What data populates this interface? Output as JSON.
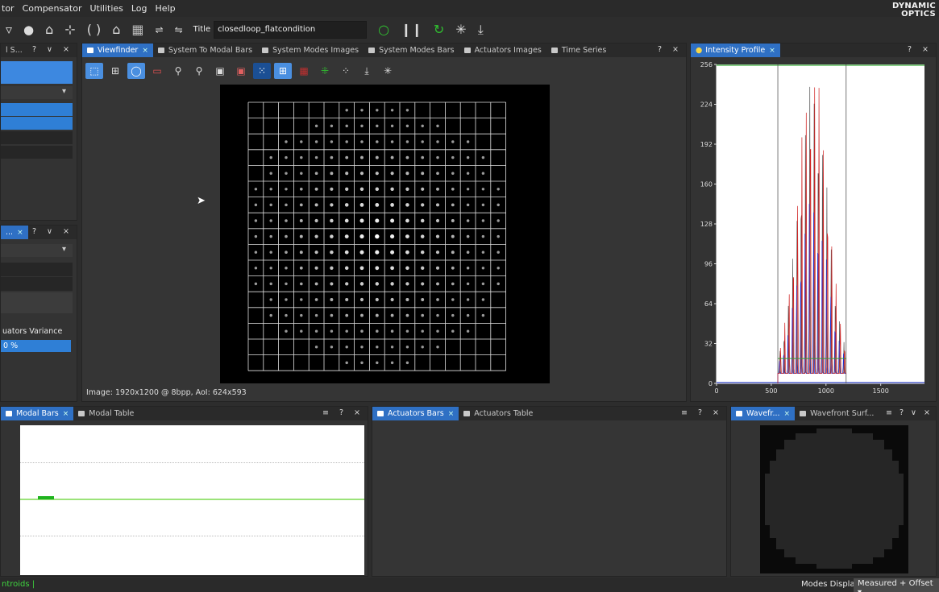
{
  "menu": [
    "tor",
    "Compensator",
    "Utilities",
    "Log",
    "Help"
  ],
  "logo": {
    "line1": "DYNAMIC",
    "line2": "OPTICS"
  },
  "toolbar": {
    "title_label": "Title",
    "title_value": "closedloop_flatcondition"
  },
  "left_panel_top": {
    "title": "l S...",
    "controls": "? ∨ ×"
  },
  "left_panel_bottom": {
    "tab": "...",
    "controls": "? ∨ ×",
    "variance_label": "uators Variance",
    "variance_value": "0 %"
  },
  "viewfinder": {
    "tabs": [
      {
        "label": "Viewfinder",
        "active": true,
        "closable": true
      },
      {
        "label": "System To Modal Bars",
        "active": false
      },
      {
        "label": "System Modes Images",
        "active": false
      },
      {
        "label": "System Modes Bars",
        "active": false
      },
      {
        "label": "Actuators Images",
        "active": false
      },
      {
        "label": "Time Series",
        "active": false
      }
    ],
    "controls": "? ×",
    "info": "Image: 1920x1200 @ 8bpp, AoI: 624x593",
    "grid_cols": 17,
    "grid_rows": 17
  },
  "intensity": {
    "tab": "Intensity Profile",
    "controls": "? ×",
    "y_ticks": [
      "256",
      "224",
      "192",
      "160",
      "128",
      "96",
      "64",
      "32",
      "0"
    ],
    "x_ticks": [
      "0",
      "500",
      "1000",
      "1500"
    ]
  },
  "modal": {
    "tabs": [
      "Modal Bars",
      "Modal Table"
    ],
    "controls": "≡ ? ×"
  },
  "actuators": {
    "tabs": [
      "Actuators Bars",
      "Actuators Table"
    ],
    "controls": "≡ ? ×"
  },
  "wavefront": {
    "tabs": [
      "Wavefr...",
      "Wavefront Surf..."
    ],
    "controls": "≡ ? ∨ ×"
  },
  "status": {
    "left": "ntroids |",
    "modes_label": "Modes Display",
    "modes_value": "Measured + Offset"
  },
  "colors": {
    "accent": "#2f7fd6",
    "green": "#30c030"
  }
}
